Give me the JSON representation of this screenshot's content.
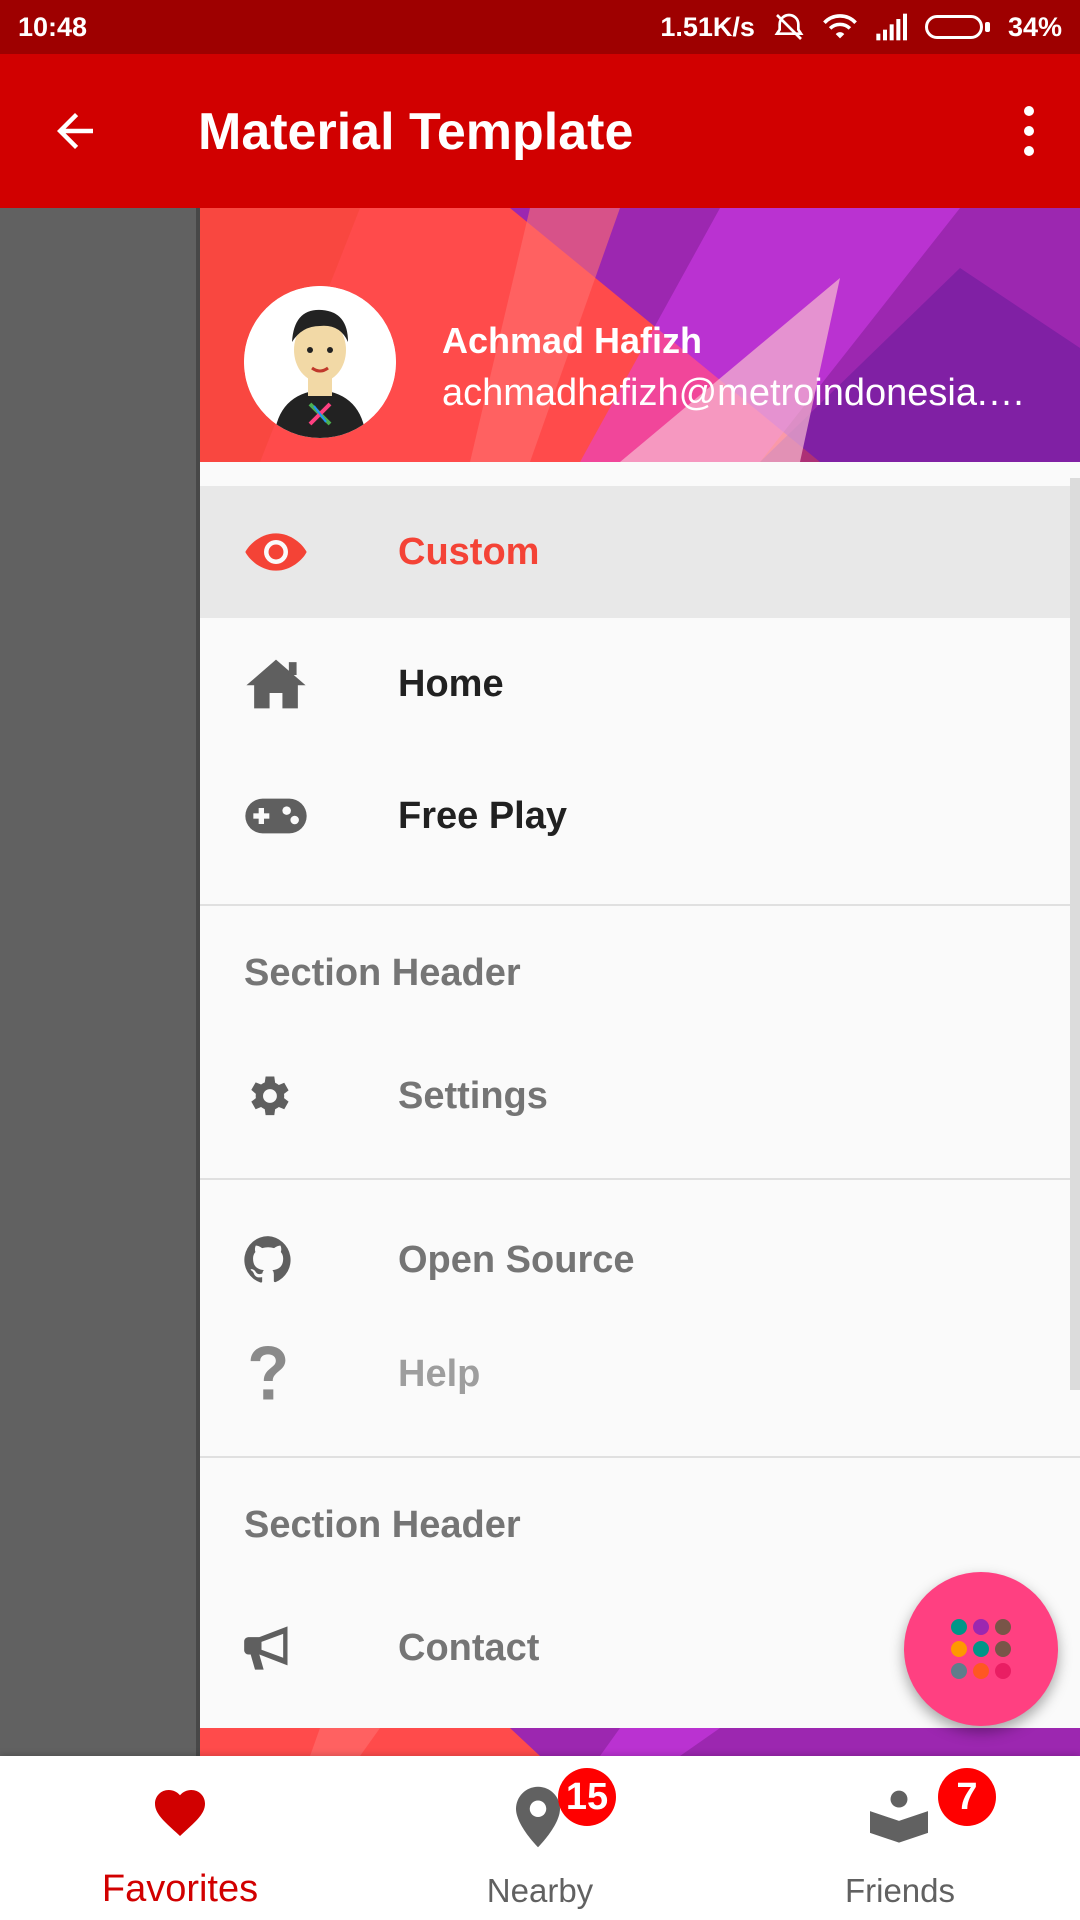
{
  "status_bar": {
    "time": "10:48",
    "speed": "1.51K/s",
    "battery": "34%",
    "battery_level": 0.34
  },
  "app_bar": {
    "title": "Material Template",
    "back_icon": "arrow-left-icon",
    "menu_icon": "more-vert-icon"
  },
  "drawer": {
    "header": {
      "name": "Achmad Hafizh",
      "email": "achmadhafizh@metroindonesia.…"
    },
    "items": [
      {
        "label": "Custom",
        "icon": "eye-icon",
        "selected": true
      },
      {
        "label": "Home",
        "icon": "home-icon"
      },
      {
        "label": "Free Play",
        "icon": "gamepad-icon"
      }
    ],
    "section1": {
      "header": "Section Header",
      "items": [
        {
          "label": "Settings",
          "icon": "gear-icon"
        }
      ]
    },
    "group2": [
      {
        "label": "Open Source",
        "icon": "github-icon"
      },
      {
        "label": "Help",
        "icon": "question-icon"
      }
    ],
    "section2": {
      "header": "Section Header",
      "items": [
        {
          "label": "Contact",
          "icon": "megaphone-icon"
        }
      ]
    }
  },
  "fab": {
    "icon": "apps-grid-icon",
    "color": "#ff4081"
  },
  "bottom_nav": {
    "items": [
      {
        "label": "Favorites",
        "icon": "heart-icon",
        "active": true
      },
      {
        "label": "Nearby",
        "icon": "map-pin-icon",
        "badge": "15"
      },
      {
        "label": "Friends",
        "icon": "reader-icon",
        "badge": "7"
      }
    ]
  },
  "colors": {
    "primary": "#d10000",
    "primary_dark": "#9e0000",
    "accent": "#f44336",
    "fab": "#ff4081"
  }
}
